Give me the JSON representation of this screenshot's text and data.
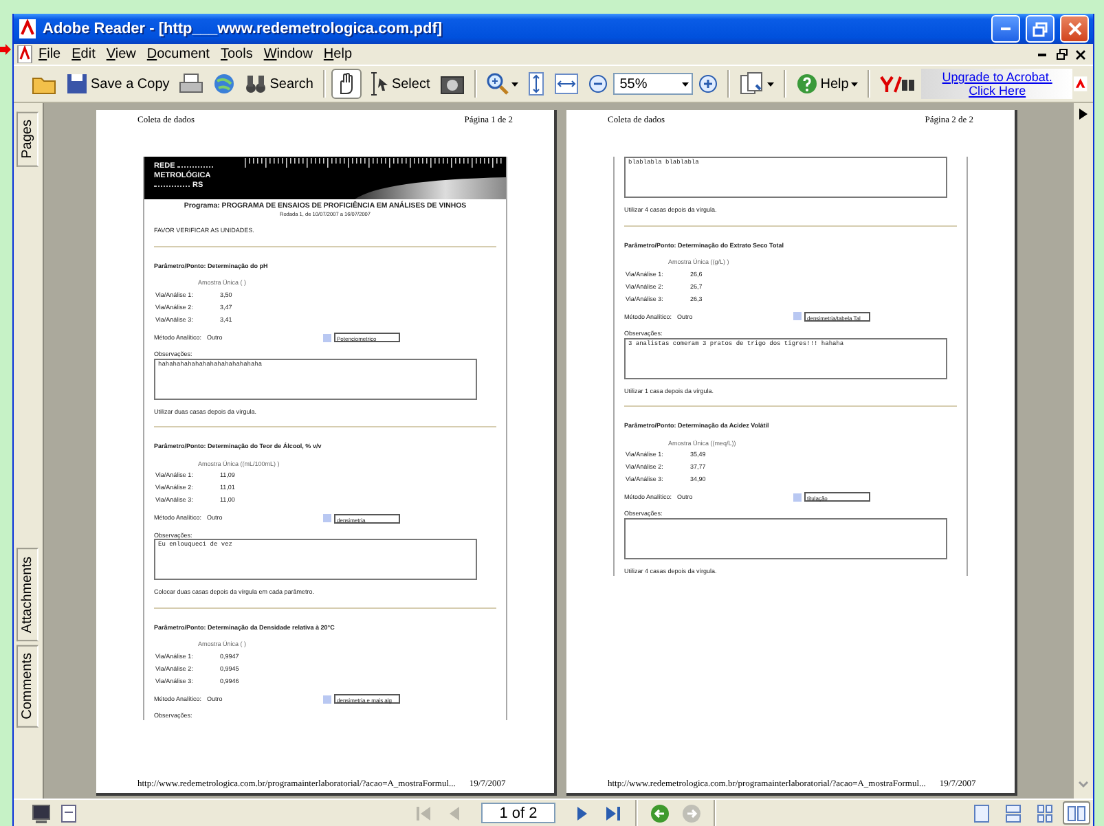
{
  "window": {
    "title": "Adobe Reader - [http___www.redemetrologica.com.pdf]"
  },
  "menu": [
    "File",
    "Edit",
    "View",
    "Document",
    "Tools",
    "Window",
    "Help"
  ],
  "toolbar": {
    "save_copy": "Save a Copy",
    "search": "Search",
    "hand_selected": true,
    "select": "Select",
    "zoom": "55%",
    "help": "Help",
    "upgrade": [
      "Upgrade to Acrobat.",
      "Click Here"
    ]
  },
  "side_tabs": [
    "Pages",
    "Attachments",
    "Comments"
  ],
  "pages": [
    {
      "header_left": "Coleta de dados",
      "header_right": "Página 1 de 2",
      "blocks": [
        {
          "kind": "banner",
          "logo": [
            "REDE",
            "METROLÓGICA",
            "RS"
          ],
          "title": "Programa: PROGRAMA DE ENSAIOS DE PROFICIÊNCIA EM ANÁLISES DE VINHOS",
          "subtitle": "Rodada 1, de 10/07/2007 a 16/07/2007",
          "notice": "FAVOR VERIFICAR AS UNIDADES."
        },
        {
          "kind": "section",
          "title": "Parâmetro/Ponto: Determinação do pH",
          "sample": "Amostra Única ( )",
          "rows": [
            {
              "label": "Via/Análise 1:",
              "value": "3,50"
            },
            {
              "label": "Via/Análise 2:",
              "value": "3,47"
            },
            {
              "label": "Via/Análise 3:",
              "value": "3,41"
            }
          ],
          "method_label": "Método Analítico:",
          "method_value": "Outro",
          "method_field": "Potenciometrico",
          "obs_label": "Observações:",
          "obs_text": "hahahahahahahahahahahahahaha",
          "note": "Utilizar duas casas depois da vírgula."
        },
        {
          "kind": "section",
          "title": "Parâmetro/Ponto: Determinação do Teor de Álcool, % v/v",
          "sample": "Amostra Única ((mL/100mL) )",
          "rows": [
            {
              "label": "Via/Análise 1:",
              "value": "11,09"
            },
            {
              "label": "Via/Análise 2:",
              "value": "11,01"
            },
            {
              "label": "Via/Análise 3:",
              "value": "11,00"
            }
          ],
          "method_label": "Método Analítico:",
          "method_value": "Outro",
          "method_field": "densimetria",
          "obs_label": "Observações:",
          "obs_text": "Eu enlouqueci de vez",
          "note": "Colocar duas casas depois da vírgula em cada parâmetro."
        },
        {
          "kind": "section_cut",
          "title": "Parâmetro/Ponto: Determinação da Densidade relativa à 20°C",
          "sample": "Amostra Única ( )",
          "rows": [
            {
              "label": "Via/Análise 1:",
              "value": "0,9947"
            },
            {
              "label": "Via/Análise 2:",
              "value": "0,9945"
            },
            {
              "label": "Via/Análise 3:",
              "value": "0,9946"
            }
          ],
          "method_label": "Método Analítico:",
          "method_value": "Outro",
          "method_field": "densimetria e mais alg",
          "obs_label": "Observações:"
        }
      ],
      "footer_url": "http://www.redemetrologica.com.br/programainterlaboratorial/?acao=A_mostraFormul...",
      "footer_date": "19/7/2007"
    },
    {
      "header_left": "Coleta de dados",
      "header_right": "Página 2 de 2",
      "blocks": [
        {
          "kind": "continuation",
          "obs_text": "blablabla blablabla",
          "note": "Utilizar 4 casas depois da vírgula."
        },
        {
          "kind": "section",
          "title": "Parâmetro/Ponto: Determinação do Extrato Seco Total",
          "sample": "Amostra Única ((g/L) )",
          "rows": [
            {
              "label": "Via/Análise 1:",
              "value": "26,6"
            },
            {
              "label": "Via/Análise 2:",
              "value": "26,7"
            },
            {
              "label": "Via/Análise 3:",
              "value": "26,3"
            }
          ],
          "method_label": "Método Analítico:",
          "method_value": "Outro",
          "method_field": "densimetria/tabela Tal",
          "obs_label": "Observações:",
          "obs_text": "3 analistas comeram 3 pratos de trigo dos tigres!!! hahaha",
          "note": "Utilizar 1 casa depois da vírgula."
        },
        {
          "kind": "section",
          "title": "Parâmetro/Ponto: Determinação da Acidez Volátil",
          "sample": "Amostra Única ((meq/L))",
          "rows": [
            {
              "label": "Via/Análise 1:",
              "value": "35,49"
            },
            {
              "label": "Via/Análise 2:",
              "value": "37,77"
            },
            {
              "label": "Via/Análise 3:",
              "value": "34,90"
            }
          ],
          "method_label": "Método Analítico:",
          "method_value": "Outro",
          "method_field": "titulação",
          "obs_label": "Observações:",
          "note": "Utilizar 4 casas depois da vírgula."
        }
      ],
      "footer_url": "http://www.redemetrologica.com.br/programainterlaboratorial/?acao=A_mostraFormul...",
      "footer_date": "19/7/2007"
    }
  ],
  "status_bar": {
    "nav": [
      {
        "disabled": true
      },
      {
        "disabled": true
      },
      {
        "disabled": false
      },
      {
        "disabled": false
      }
    ],
    "page_field": "1 of 2",
    "history": [
      {
        "disabled": false
      },
      {
        "disabled": true
      }
    ],
    "views": [
      {
        "selected": false
      },
      {
        "selected": false
      },
      {
        "selected": false
      },
      {
        "selected": true
      }
    ]
  }
}
